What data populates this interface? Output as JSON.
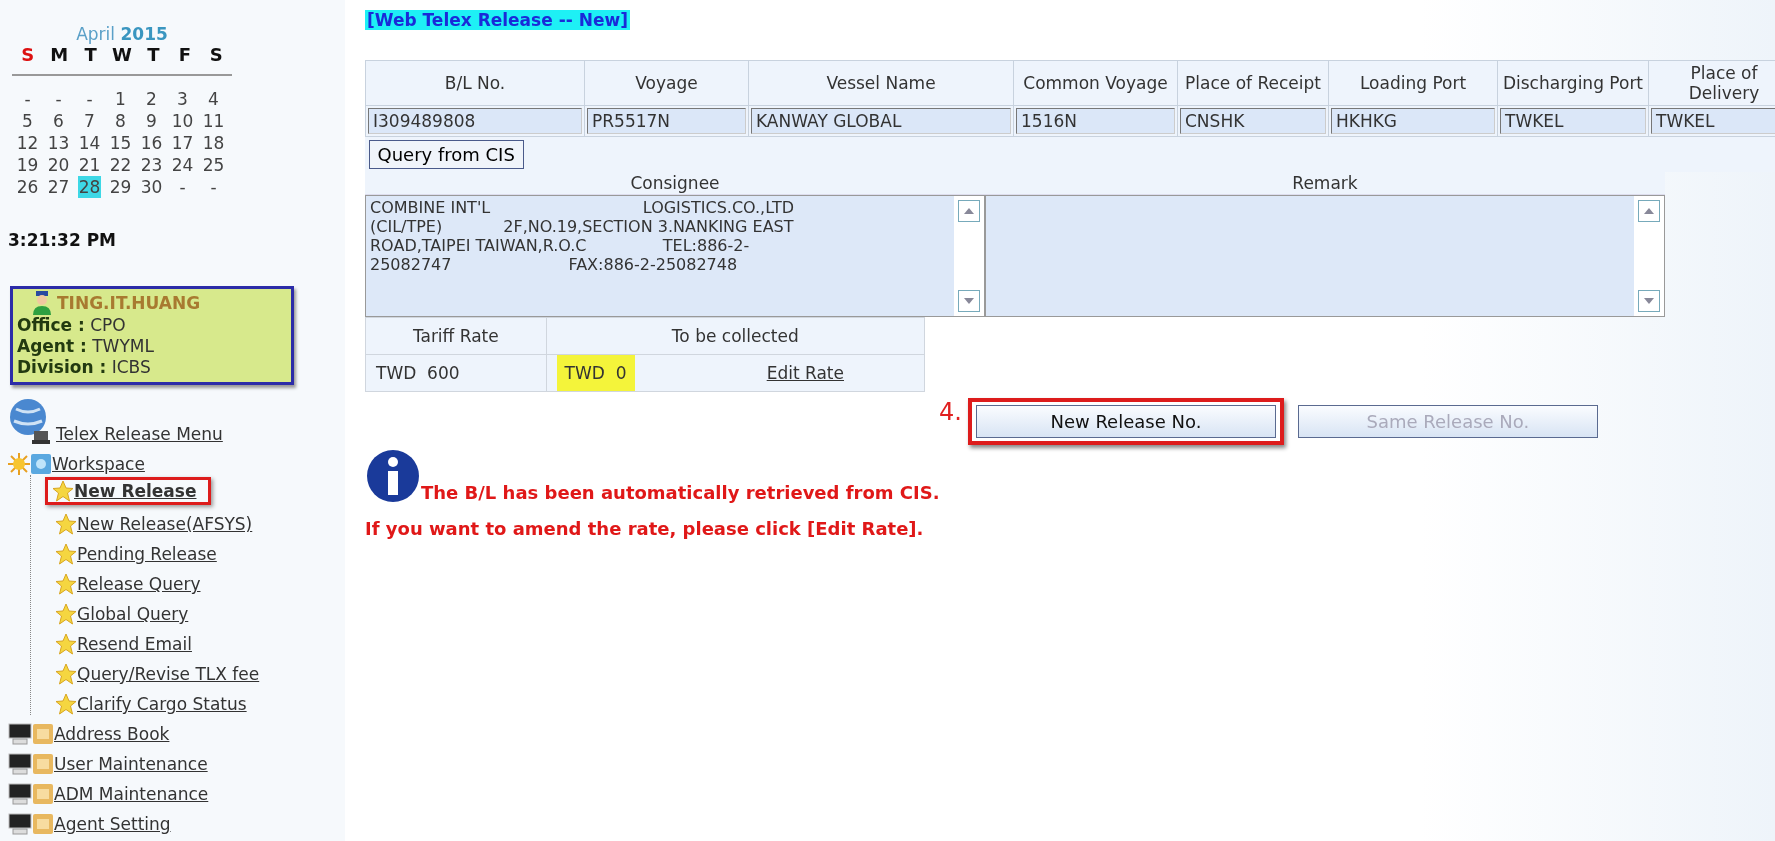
{
  "calendar": {
    "month": "April",
    "year": "2015",
    "weekdays": [
      {
        "label": "S",
        "color": "#dd1111"
      },
      {
        "label": "M",
        "color": "#111111"
      },
      {
        "label": "T",
        "color": "#111111"
      },
      {
        "label": "W",
        "color": "#111111"
      },
      {
        "label": "T",
        "color": "#111111"
      },
      {
        "label": "F",
        "color": "#111111"
      },
      {
        "label": "S",
        "color": "#111111"
      }
    ],
    "weeks": [
      [
        {
          "day": "-",
          "selected": false
        },
        {
          "day": "-",
          "selected": false
        },
        {
          "day": "-",
          "selected": false
        },
        {
          "day": "1",
          "selected": false
        },
        {
          "day": "2",
          "selected": false
        },
        {
          "day": "3",
          "selected": false
        },
        {
          "day": "4",
          "selected": false
        }
      ],
      [
        {
          "day": "5",
          "selected": false
        },
        {
          "day": "6",
          "selected": false
        },
        {
          "day": "7",
          "selected": false
        },
        {
          "day": "8",
          "selected": false
        },
        {
          "day": "9",
          "selected": false
        },
        {
          "day": "10",
          "selected": false
        },
        {
          "day": "11",
          "selected": false
        }
      ],
      [
        {
          "day": "12",
          "selected": false
        },
        {
          "day": "13",
          "selected": false
        },
        {
          "day": "14",
          "selected": false
        },
        {
          "day": "15",
          "selected": false
        },
        {
          "day": "16",
          "selected": false
        },
        {
          "day": "17",
          "selected": false
        },
        {
          "day": "18",
          "selected": false
        }
      ],
      [
        {
          "day": "19",
          "selected": false
        },
        {
          "day": "20",
          "selected": false
        },
        {
          "day": "21",
          "selected": false
        },
        {
          "day": "22",
          "selected": false
        },
        {
          "day": "23",
          "selected": false
        },
        {
          "day": "24",
          "selected": false
        },
        {
          "day": "25",
          "selected": false
        }
      ],
      [
        {
          "day": "26",
          "selected": false
        },
        {
          "day": "27",
          "selected": false
        },
        {
          "day": "28",
          "selected": true
        },
        {
          "day": "29",
          "selected": false
        },
        {
          "day": "30",
          "selected": false
        },
        {
          "day": "-",
          "selected": false
        },
        {
          "day": "-",
          "selected": false
        }
      ]
    ]
  },
  "clock": "3:21:32 PM",
  "user": {
    "name": "TING.IT.HUANG",
    "lines": [
      "**Office :** CPO",
      "**Agent :** TWYML",
      "**Division :** ICBS"
    ]
  },
  "menu": [
    {
      "label": "Telex Release Menu",
      "kind": "globe"
    },
    {
      "label": "Workspace",
      "kind": "workspace",
      "expanded": true,
      "children": [
        {
          "label": "New Release",
          "kind": "star",
          "selected": true
        },
        {
          "label": "New Release(AFSYS)",
          "kind": "star",
          "selected": false
        },
        {
          "label": "Pending Release",
          "kind": "star",
          "selected": false
        },
        {
          "label": "Release Query",
          "kind": "star",
          "selected": false
        },
        {
          "label": "Global Query",
          "kind": "star",
          "selected": false
        },
        {
          "label": "Resend Email",
          "kind": "star",
          "selected": false
        },
        {
          "label": "Query/Revise TLX fee",
          "kind": "star",
          "selected": false
        },
        {
          "label": "Clarify Cargo Status",
          "kind": "star",
          "selected": false
        }
      ]
    },
    {
      "label": "Address Book",
      "kind": "module"
    },
    {
      "label": "User Maintenance",
      "kind": "module"
    },
    {
      "label": "ADM Maintenance",
      "kind": "module"
    },
    {
      "label": "Agent Setting",
      "kind": "module"
    }
  ],
  "page_title": "[Web Telex Release -- New]",
  "form": {
    "columns": [
      "B/L No.",
      "Voyage",
      "Vessel Name",
      "Common Voyage",
      "Place of Receipt",
      "Loading Port",
      "Discharging Port",
      "Place of Delivery"
    ],
    "values": [
      "I309489808",
      "PR5517N",
      "KANWAY GLOBAL",
      "1516N",
      "CNSHK",
      "HKHKG",
      "TWKEL",
      "TWKEL"
    ],
    "query_button": "Query from CIS",
    "consignee": {
      "label": "Consignee",
      "lines": [
        "COMBINE INT'L                              LOGISTICS.CO.,LTD",
        "(CIL/TPE)            2F,NO.19,SECTION 3.NANKING EAST",
        "ROAD,TAIPEI TAIWAN,R.O.C               TEL:886-2-",
        "25082747                       FAX:886-2-25082748"
      ]
    },
    "remark": {
      "label": "Remark"
    },
    "tariff": {
      "headers": [
        "Tariff Rate",
        "To be collected"
      ],
      "rate": "TWD  600",
      "collected": {
        "text": "TWD  0",
        "highlighted": true
      },
      "edit_link": "Edit Rate"
    }
  },
  "actions": {
    "step_label": "4.",
    "buttons": [
      {
        "label": "New Release No.",
        "disabled": false,
        "highlighted": true
      },
      {
        "label": "Same Release No.",
        "disabled": true,
        "highlighted": false
      }
    ]
  },
  "messages": [
    "The B/L has been automatically retrieved from CIS.",
    "If you want to amend the rate, please click [Edit Rate]."
  ]
}
